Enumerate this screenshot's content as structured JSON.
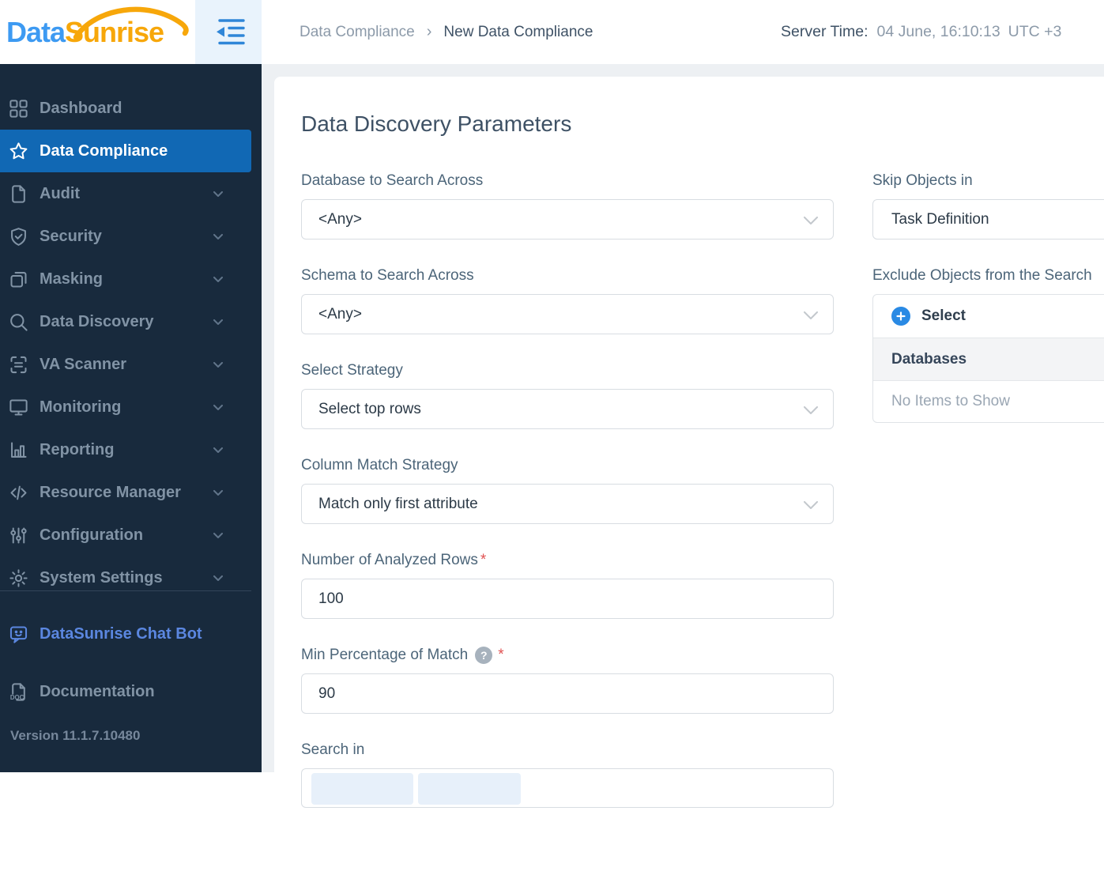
{
  "header": {
    "logo_part1": "Data",
    "logo_part2": "Sunrise",
    "breadcrumb": {
      "parent": "Data Compliance",
      "separator": "›",
      "current": "New Data Compliance"
    },
    "server_time": {
      "label": "Server Time:",
      "time": "04 June, 16:10:13",
      "timezone": "UTC +3"
    }
  },
  "sidebar": {
    "items": [
      {
        "label": "Dashboard",
        "icon": "dashboard-icon",
        "active": false,
        "has_submenu": false
      },
      {
        "label": "Data Compliance",
        "icon": "star-icon",
        "active": true,
        "has_submenu": false
      },
      {
        "label": "Audit",
        "icon": "document-icon",
        "active": false,
        "has_submenu": true
      },
      {
        "label": "Security",
        "icon": "shield-check-icon",
        "active": false,
        "has_submenu": true
      },
      {
        "label": "Masking",
        "icon": "copy-icon",
        "active": false,
        "has_submenu": true
      },
      {
        "label": "Data Discovery",
        "icon": "search-icon",
        "active": false,
        "has_submenu": true
      },
      {
        "label": "VA Scanner",
        "icon": "scanner-icon",
        "active": false,
        "has_submenu": true
      },
      {
        "label": "Monitoring",
        "icon": "monitor-icon",
        "active": false,
        "has_submenu": true
      },
      {
        "label": "Reporting",
        "icon": "bar-chart-icon",
        "active": false,
        "has_submenu": true
      },
      {
        "label": "Resource Manager",
        "icon": "code-icon",
        "active": false,
        "has_submenu": true
      },
      {
        "label": "Configuration",
        "icon": "sliders-icon",
        "active": false,
        "has_submenu": true
      },
      {
        "label": "System Settings",
        "icon": "gear-icon",
        "active": false,
        "has_submenu": true
      }
    ],
    "chat_bot_label": "DataSunrise Chat Bot",
    "documentation_label": "Documentation",
    "documentation_icon_text": "DOC",
    "version": "Version 11.1.7.10480"
  },
  "main": {
    "title": "Data Discovery Parameters",
    "fields": {
      "database": {
        "label": "Database to Search Across",
        "value": "<Any>"
      },
      "schema": {
        "label": "Schema to Search Across",
        "value": "<Any>"
      },
      "select_strategy": {
        "label": "Select Strategy",
        "value": "Select top rows"
      },
      "column_match_strategy": {
        "label": "Column Match Strategy",
        "value": "Match only first attribute"
      },
      "analyzed_rows": {
        "label": "Number of Analyzed Rows",
        "required_mark": "*",
        "value": "100"
      },
      "min_percentage": {
        "label": "Min Percentage of Match",
        "required_mark": "*",
        "help_glyph": "?",
        "value": "90"
      },
      "search_in": {
        "label": "Search in"
      }
    },
    "side_panel": {
      "skip_objects": {
        "label": "Skip Objects in",
        "value": "Task Definition"
      },
      "exclude_objects": {
        "label": "Exclude Objects from the Search",
        "select_button_label": "Select",
        "group_header": "Databases",
        "empty_text": "No Items to Show"
      }
    }
  },
  "colors": {
    "sidebar_bg": "#182a3d",
    "active_item_blue": "#1168b4",
    "logo_blue": "#3d9af2",
    "logo_orange": "#f7a70a",
    "accent_blue": "#2a8ae4",
    "required_red": "#e05252",
    "chat_bot_blue": "#5b87e0",
    "content_bg": "#edf0f3"
  }
}
